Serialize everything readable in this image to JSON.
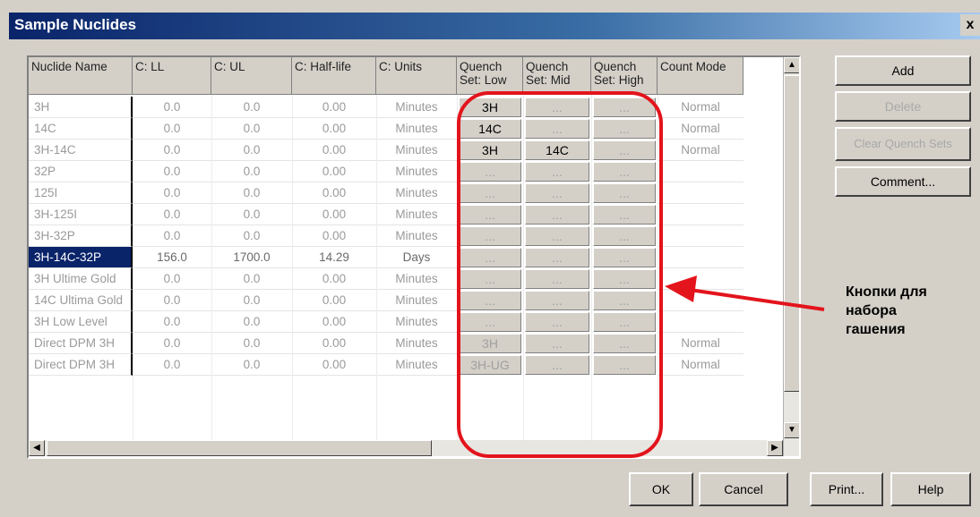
{
  "window": {
    "title": "Sample Nuclides",
    "close_glyph": "x"
  },
  "table": {
    "headers": [
      "Nuclide Name",
      "C: LL",
      "C: UL",
      "C: Half-life",
      "C: Units",
      "Quench Set: Low",
      "Quench Set: Mid",
      "Quench Set: High",
      "Count Mode"
    ],
    "rows": [
      {
        "name": "3H",
        "ll": "0.0",
        "ul": "0.0",
        "half": "0.00",
        "units": "Minutes",
        "low": "3H",
        "mid": "...",
        "high": "...",
        "mode": "Normal"
      },
      {
        "name": "14C",
        "ll": "0.0",
        "ul": "0.0",
        "half": "0.00",
        "units": "Minutes",
        "low": "14C",
        "mid": "...",
        "high": "...",
        "mode": "Normal"
      },
      {
        "name": "3H-14C",
        "ll": "0.0",
        "ul": "0.0",
        "half": "0.00",
        "units": "Minutes",
        "low": "3H",
        "mid": "14C",
        "high": "...",
        "mode": "Normal"
      },
      {
        "name": "32P",
        "ll": "0.0",
        "ul": "0.0",
        "half": "0.00",
        "units": "Minutes",
        "low": "...",
        "mid": "...",
        "high": "...",
        "mode": ""
      },
      {
        "name": "125I",
        "ll": "0.0",
        "ul": "0.0",
        "half": "0.00",
        "units": "Minutes",
        "low": "...",
        "mid": "...",
        "high": "...",
        "mode": ""
      },
      {
        "name": "3H-125I",
        "ll": "0.0",
        "ul": "0.0",
        "half": "0.00",
        "units": "Minutes",
        "low": "...",
        "mid": "...",
        "high": "...",
        "mode": ""
      },
      {
        "name": "3H-32P",
        "ll": "0.0",
        "ul": "0.0",
        "half": "0.00",
        "units": "Minutes",
        "low": "...",
        "mid": "...",
        "high": "...",
        "mode": ""
      },
      {
        "name": "3H-14C-32P",
        "ll": "156.0",
        "ul": "1700.0",
        "half": "14.29",
        "units": "Days",
        "low": "...",
        "mid": "...",
        "high": "...",
        "mode": ""
      },
      {
        "name": "3H Ultime Gold",
        "ll": "0.0",
        "ul": "0.0",
        "half": "0.00",
        "units": "Minutes",
        "low": "...",
        "mid": "...",
        "high": "...",
        "mode": ""
      },
      {
        "name": "14C Ultima Gold",
        "ll": "0.0",
        "ul": "0.0",
        "half": "0.00",
        "units": "Minutes",
        "low": "...",
        "mid": "...",
        "high": "...",
        "mode": ""
      },
      {
        "name": "3H Low Level",
        "ll": "0.0",
        "ul": "0.0",
        "half": "0.00",
        "units": "Minutes",
        "low": "...",
        "mid": "...",
        "high": "...",
        "mode": ""
      },
      {
        "name": "Direct DPM 3H",
        "ll": "0.0",
        "ul": "0.0",
        "half": "0.00",
        "units": "Minutes",
        "low": "3H",
        "mid": "...",
        "high": "...",
        "mode": "Normal"
      },
      {
        "name": "Direct DPM 3H",
        "ll": "0.0",
        "ul": "0.0",
        "half": "0.00",
        "units": "Minutes",
        "low": "3H-UG",
        "mid": "...",
        "high": "...",
        "mode": "Normal"
      }
    ],
    "selected_row": 7
  },
  "side_buttons": {
    "add": "Add",
    "delete": "Delete",
    "clear": "Clear Quench Sets",
    "comment": "Comment..."
  },
  "bottom_buttons": {
    "ok": "OK",
    "cancel": "Cancel",
    "print": "Print...",
    "help": "Help"
  },
  "annotation": {
    "line1": "Кнопки для",
    "line2": "набора",
    "line3": "гашения"
  },
  "icons": {
    "close": "close-icon",
    "scroll_up": "scroll-up-icon",
    "scroll_down": "scroll-down-icon",
    "scroll_left": "scroll-left-icon",
    "scroll_right": "scroll-right-icon"
  },
  "colors": {
    "highlight": "#e3141c",
    "selection": "#0a246a"
  }
}
